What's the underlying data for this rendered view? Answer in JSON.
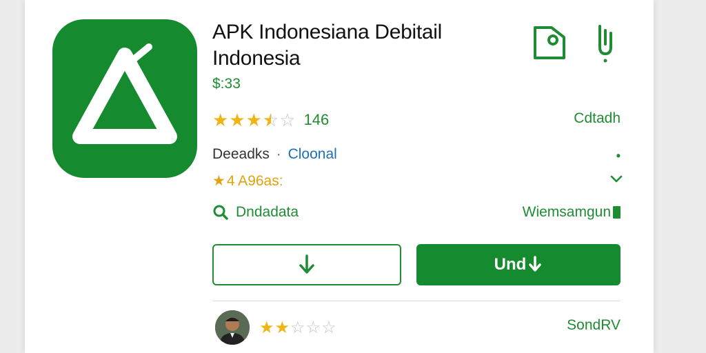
{
  "app": {
    "title": "APK Indonesiana Debitail Indonesia",
    "price": "$:33",
    "rating_stars": 3.5,
    "rating_count": "146",
    "top_right_link": "Cdtadh",
    "details_label": "Deeadks",
    "details_separator": "·",
    "details_link": "Cloonal",
    "award_text": "4 A96as:",
    "search_label": "Dndadata",
    "developer_link": "Wiemsamgun",
    "primary_button_label": "Und",
    "dot_symbol": "•"
  },
  "review": {
    "stars": 2,
    "link": "SondRV"
  },
  "icons": {
    "app_icon": "triangle-logo-icon",
    "wishlist": "bookmark-icon",
    "share": "share-icon",
    "search": "search-icon",
    "chevron": "chevron-down-icon",
    "download": "download-arrow-icon"
  },
  "colors": {
    "brand_green": "#158a2e",
    "text_green": "#1e8c32",
    "star_yellow": "#f0b414",
    "link_blue": "#1a6fb8"
  }
}
